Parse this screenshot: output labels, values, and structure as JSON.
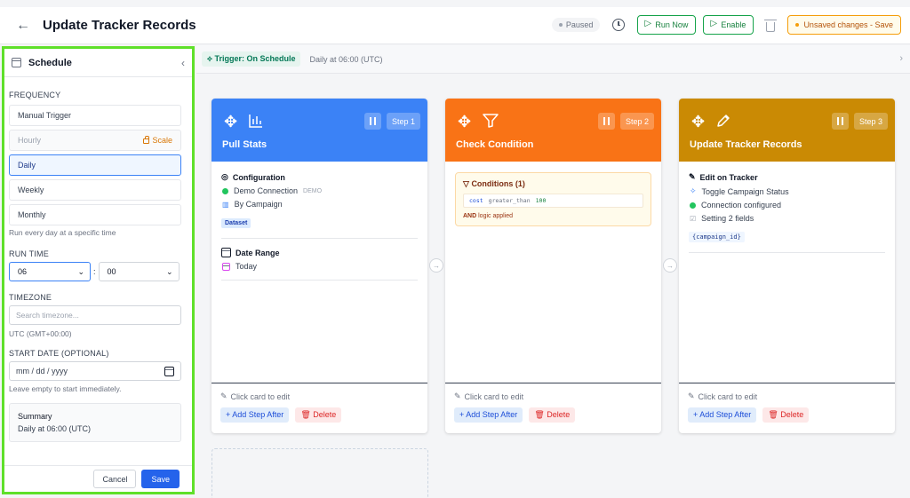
{
  "header": {
    "back": "←",
    "title": "Update Tracker Records",
    "status": "Paused",
    "run_now": "Run Now",
    "enable": "Enable",
    "unsaved": "Unsaved changes - Save"
  },
  "sidebar": {
    "title": "Schedule",
    "collapse": "‹",
    "frequency_label": "FREQUENCY",
    "frequency_options": [
      {
        "label": "Manual Trigger"
      },
      {
        "label": "Hourly",
        "badge": "Scale"
      },
      {
        "label": "Daily"
      },
      {
        "label": "Weekly"
      },
      {
        "label": "Monthly"
      }
    ],
    "frequency_hint": "Run every day at a specific time",
    "run_time_label": "RUN TIME",
    "hour": "06",
    "minute": "00",
    "separator": ":",
    "timezone_label": "TIMEZONE",
    "timezone_placeholder": "Search timezone...",
    "timezone_value": "UTC (GMT+00:00)",
    "start_date_label": "START DATE (OPTIONAL)",
    "start_date_placeholder": "mm / dd / yyyy",
    "start_date_hint": "Leave empty to start immediately.",
    "summary_title": "Summary",
    "summary_value": "Daily at 06:00 (UTC)",
    "cancel": "Cancel",
    "save": "Save"
  },
  "trigger": {
    "label": "Trigger: On Schedule",
    "sub": "Daily at 06:00 (UTC)"
  },
  "cards": [
    {
      "title": "Pull Stats",
      "step": "Step 1",
      "color": "#3b82f6",
      "config_title": "Configuration",
      "connection": "Demo Connection",
      "demo": "DEMO",
      "by": "By Campaign",
      "tag": "Dataset",
      "range_title": "Date Range",
      "range_value": "Today"
    },
    {
      "title": "Check Condition",
      "step": "Step 2",
      "color": "#f97316",
      "cond_title": "Conditions (1)",
      "cond_field": "cost",
      "cond_op": "greater_than",
      "cond_val": "100",
      "cond_and_bold": "AND",
      "cond_and_rest": "logic applied"
    },
    {
      "title": "Update Tracker Records",
      "step": "Step 3",
      "color": "#ca8a04",
      "edit_title": "Edit on Tracker",
      "toggle": "Toggle Campaign Status",
      "connection": "Connection configured",
      "setting": "Setting 2 fields",
      "code": "{campaign_id}"
    }
  ],
  "card_footer": {
    "hint": "Click card to edit",
    "add": "+ Add Step After",
    "delete": "Delete"
  }
}
